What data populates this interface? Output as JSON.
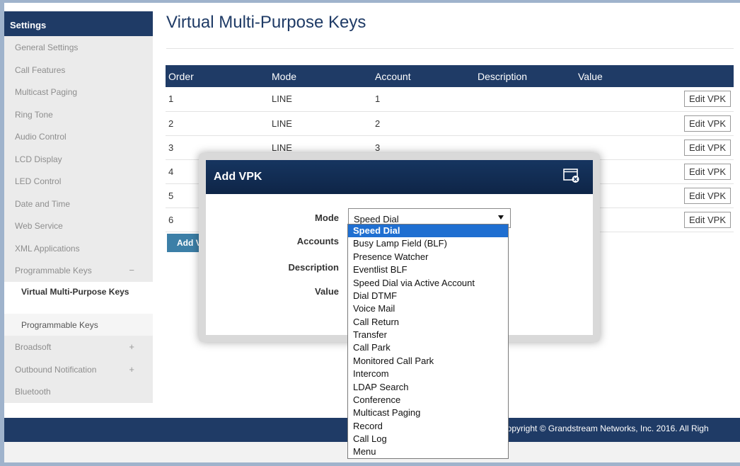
{
  "sidebar": {
    "header": "Settings",
    "items": [
      {
        "label": "General Settings"
      },
      {
        "label": "Call Features"
      },
      {
        "label": "Multicast Paging"
      },
      {
        "label": "Ring Tone"
      },
      {
        "label": "Audio Control"
      },
      {
        "label": "LCD Display"
      },
      {
        "label": "LED Control"
      },
      {
        "label": "Date and Time"
      },
      {
        "label": "Web Service"
      },
      {
        "label": "XML Applications"
      },
      {
        "label": "Programmable Keys",
        "toggle": "−"
      },
      {
        "label": "Virtual Multi-Purpose Keys",
        "sub": true,
        "active": true
      },
      {
        "label": "Programmable Keys",
        "sub": true
      },
      {
        "label": "Broadsoft",
        "toggle": "+"
      },
      {
        "label": "Outbound Notification",
        "toggle": "+"
      },
      {
        "label": "Bluetooth"
      }
    ]
  },
  "page": {
    "title": "Virtual Multi-Purpose Keys"
  },
  "table": {
    "headers": [
      "Order",
      "Mode",
      "Account",
      "Description",
      "Value"
    ],
    "rows": [
      {
        "order": "1",
        "mode": "LINE",
        "account": "1",
        "description": "",
        "value": ""
      },
      {
        "order": "2",
        "mode": "LINE",
        "account": "2",
        "description": "",
        "value": ""
      },
      {
        "order": "3",
        "mode": "LINE",
        "account": "3",
        "description": "",
        "value": ""
      },
      {
        "order": "4",
        "mode": "",
        "account": "",
        "description": "",
        "value": ""
      },
      {
        "order": "5",
        "mode": "",
        "account": "",
        "description": "",
        "value": ""
      },
      {
        "order": "6",
        "mode": "",
        "account": "",
        "description": "",
        "value": ""
      }
    ],
    "edit_label": "Edit VPK"
  },
  "add_button": {
    "label": "Add V"
  },
  "footer": {
    "text": "Copyright © Grandstream Networks, Inc. 2016. All Righ"
  },
  "modal": {
    "title": "Add VPK",
    "close_icon": "window-close-icon",
    "labels": {
      "mode": "Mode",
      "accounts": "Accounts",
      "description": "Description",
      "value": "Value"
    },
    "mode_value": "Speed Dial",
    "options": [
      "Speed Dial",
      "Busy Lamp Field (BLF)",
      "Presence Watcher",
      "Eventlist BLF",
      "Speed Dial via Active Account",
      "Dial DTMF",
      "Voice Mail",
      "Call Return",
      "Transfer",
      "Call Park",
      "Monitored Call Park",
      "Intercom",
      "LDAP Search",
      "Conference",
      "Multicast Paging",
      "Record",
      "Call Log",
      "Menu"
    ],
    "selected_option": "Speed Dial"
  },
  "colors": {
    "navy": "#1f3b66",
    "highlight": "#1f6fd1",
    "sidebar_bg": "#ebebeb",
    "add_button": "#3c7fa7"
  }
}
